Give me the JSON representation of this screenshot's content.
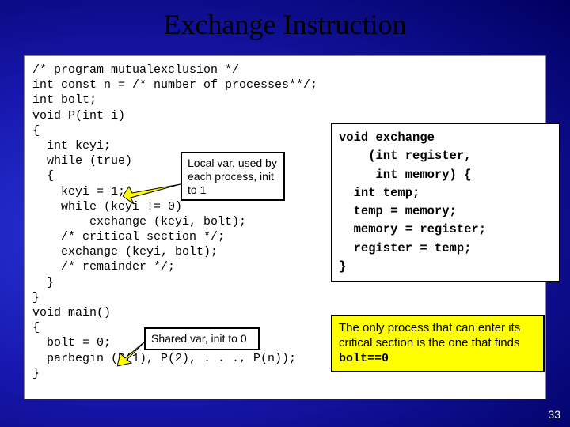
{
  "title": "Exchange Instruction",
  "code_main": "/* program mutualexclusion */\nint const n = /* number of processes**/;\nint bolt;\nvoid P(int i)\n{\n  int keyi;\n  while (true)\n  {\n    keyi = 1;\n    while (keyi != 0)\n        exchange (keyi, bolt);\n    /* critical section */;\n    exchange (keyi, bolt);\n    /* remainder */;\n  }\n}\nvoid main()\n{\n  bolt = 0;\n  parbegin (P(1), P(2), . . ., P(n));\n}",
  "callout_local": "Local var, used by each process, init  to 1",
  "callout_shared": "Shared var, init to 0",
  "code_exchange": "void exchange\n    (int register,\n     int memory) {\n  int temp;\n  temp = memory;\n  memory = register;\n  register = temp;\n}",
  "explain_pre": "The only process that can enter its critical section is the one that finds ",
  "explain_mono": "bolt==0",
  "slide_number": "33"
}
